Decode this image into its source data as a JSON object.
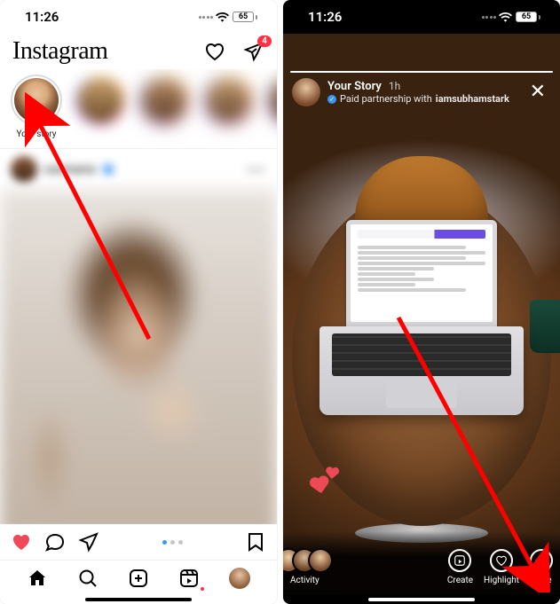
{
  "status": {
    "time": "11:26",
    "battery": "65"
  },
  "feed": {
    "logo": "Instagram",
    "messages_badge": "4",
    "stories": [
      {
        "key": "me",
        "label": "Your story"
      },
      {
        "key": "s2",
        "label": ""
      },
      {
        "key": "s3",
        "label": ""
      },
      {
        "key": "s4",
        "label": ""
      },
      {
        "key": "s5",
        "label": ""
      }
    ],
    "post_user": "username"
  },
  "story": {
    "title": "Your Story",
    "time": "1h",
    "subline_prefix": "Paid partnership with ",
    "partner": "iamsubhamstark",
    "bottom": {
      "activity": "Activity",
      "create": "Create",
      "highlight": "Highlight",
      "more": "More"
    }
  }
}
